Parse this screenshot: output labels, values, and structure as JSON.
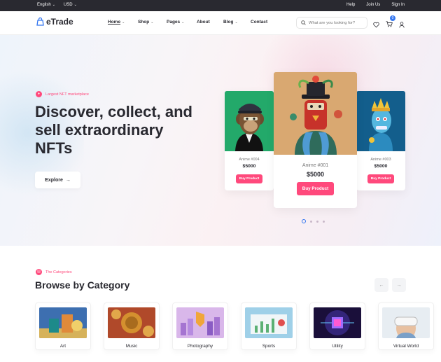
{
  "topbar": {
    "language": "English",
    "currency": "USD",
    "links": [
      "Help",
      "Join Us",
      "Sign In"
    ]
  },
  "header": {
    "logo": "eTrade",
    "nav": [
      {
        "label": "Home",
        "dropdown": true,
        "active": true
      },
      {
        "label": "Shop",
        "dropdown": true
      },
      {
        "label": "Pages",
        "dropdown": true
      },
      {
        "label": "About",
        "dropdown": false
      },
      {
        "label": "Blog",
        "dropdown": true
      },
      {
        "label": "Contact",
        "dropdown": false
      }
    ],
    "search_placeholder": "What are you looking for?",
    "cart_count": "0"
  },
  "hero": {
    "eyebrow": "Largest NFT marketplace",
    "title": "Discover, collect, and sell extraordinary NFTs",
    "explore_label": "Explore",
    "cards": [
      {
        "name": "Anime #004",
        "price": "$5000",
        "button": "Buy Product"
      },
      {
        "name": "Anime #001",
        "price": "$5000",
        "button": "Buy Product"
      },
      {
        "name": "Anime #003",
        "price": "$5000",
        "button": "Buy Product"
      }
    ]
  },
  "categories": {
    "eyebrow": "The Categories",
    "title": "Browse by Category",
    "items": [
      "Art",
      "Music",
      "Photography",
      "Sports",
      "Utility",
      "Virtual World"
    ]
  },
  "colors": {
    "accent": "#ff497c",
    "primary": "#3577f0",
    "dark": "#292930"
  }
}
